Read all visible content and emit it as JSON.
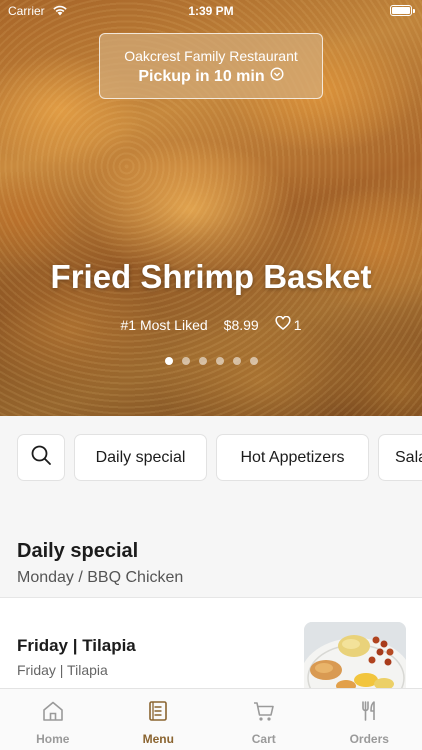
{
  "status_bar": {
    "carrier": "Carrier",
    "time": "1:39 PM"
  },
  "pickup": {
    "restaurant": "Oakcrest Family Restaurant",
    "eta": "Pickup in 10 min"
  },
  "hero": {
    "title": "Fried Shrimp Basket",
    "badge": "#1 Most Liked",
    "price": "$8.99",
    "likes": "1",
    "slide_count": 6,
    "active_slide": 1
  },
  "categories": [
    "Daily special",
    "Hot Appetizers",
    "Sala"
  ],
  "section": {
    "title": "Daily special",
    "subtitle": "Monday / BBQ Chicken"
  },
  "items": [
    {
      "title": "Friday | Tilapia",
      "description": "Friday | Tilapia"
    }
  ],
  "tabs": [
    {
      "label": "Home",
      "icon": "home-icon"
    },
    {
      "label": "Menu",
      "icon": "menu-icon",
      "active": true
    },
    {
      "label": "Cart",
      "icon": "cart-icon"
    },
    {
      "label": "Orders",
      "icon": "orders-icon"
    }
  ],
  "colors": {
    "accent": "#8a6430",
    "tab_inactive": "#9a9a9a",
    "pickup_card": "#d2aa78"
  }
}
